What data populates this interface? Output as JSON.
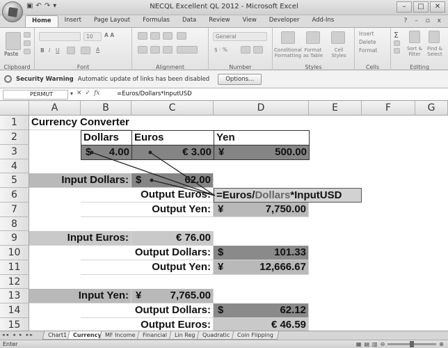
{
  "window": {
    "title": "NECQL Excellent QL 2012 - Microsoft Excel"
  },
  "ribbon": {
    "tabs": [
      "Home",
      "Insert",
      "Page Layout",
      "Formulas",
      "Data",
      "Review",
      "View",
      "Developer",
      "Add-Ins"
    ],
    "active_tab": "Home",
    "groups": {
      "clipboard": "Clipboard",
      "font": "Font",
      "alignment": "Alignment",
      "number": "Number",
      "styles": "Styles",
      "cells": "Cells",
      "editing": "Editing"
    },
    "paste_label": "Paste",
    "font_size": "10",
    "number_format": "General",
    "styles_buttons": [
      "Conditional Formatting",
      "Format as Table",
      "Cell Styles"
    ],
    "cells_buttons": [
      "Insert",
      "Delete",
      "Format"
    ],
    "editing_buttons": [
      "Sort & Filter",
      "Find & Select"
    ]
  },
  "security": {
    "title": "Security Warning",
    "message": "Automatic update of links has been disabled",
    "options_label": "Options..."
  },
  "formula_bar": {
    "name_box": "PERMUT",
    "formula": "=Euros/Dollars*InputUSD"
  },
  "columns": [
    "A",
    "B",
    "C",
    "D",
    "E",
    "F",
    "G"
  ],
  "rows": [
    "1",
    "2",
    "3",
    "4",
    "5",
    "6",
    "7",
    "8",
    "9",
    "10",
    "11",
    "12",
    "13",
    "14",
    "15"
  ],
  "sheet": {
    "title": "Currency Converter",
    "hdr_dollars": "Dollars",
    "hdr_euros": "Euros",
    "hdr_yen": "Yen",
    "rate_dollar_sym": "$",
    "rate_dollar": "4.00",
    "rate_euro": "€ 3.00",
    "rate_yen_sym": "¥",
    "rate_yen": "500.00",
    "input_dollars_label": "Input Dollars:",
    "input_dollars_sym": "$",
    "input_dollars": "62.00",
    "output_euros_label": "Output Euros:",
    "output_euros_formula": "=Euros/Dollars*InputUSD",
    "output_yen_label": "Output Yen:",
    "output_yen_sym": "¥",
    "output_yen": "7,750.00",
    "input_euros_label": "Input Euros:",
    "input_euros": "€ 76.00",
    "output_dollars_label": "Output Dollars:",
    "output_dollars_sym": "$",
    "output_dollars": "101.33",
    "output_yen2_label": "Output Yen:",
    "output_yen2_sym": "¥",
    "output_yen2": "12,666.67",
    "input_yen_label": "Input Yen:",
    "input_yen_sym": "¥",
    "input_yen": "7,765.00",
    "output_dollars2_label": "Output Dollars:",
    "output_dollars2_sym": "$",
    "output_dollars2": "62.12",
    "output_euros2_label": "Output Euros:",
    "output_euros2": "€ 46.59"
  },
  "sheet_tabs": [
    "Chart1",
    "Currency",
    "MF Income",
    "Financial",
    "Lin Reg",
    "Quadratic",
    "Coin Flipping"
  ],
  "active_sheet": "Currency",
  "status": {
    "mode": "Enter"
  }
}
